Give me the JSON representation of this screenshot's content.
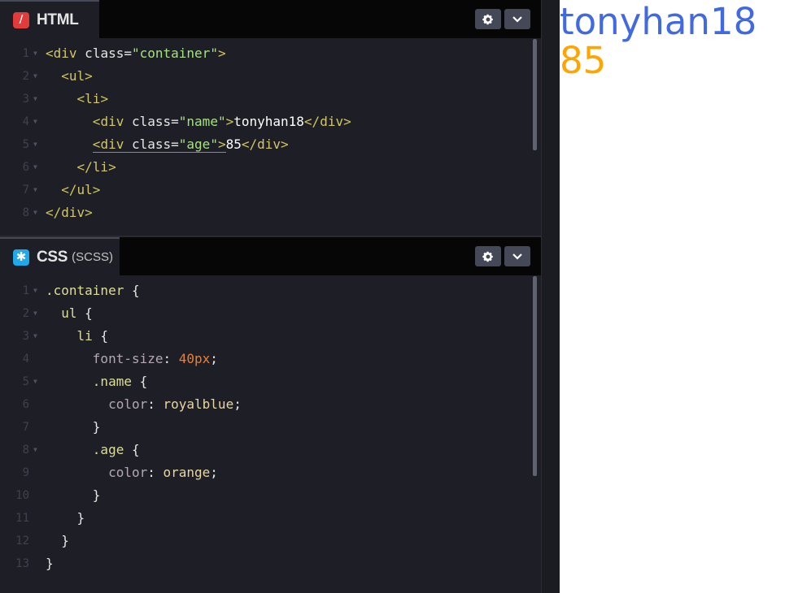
{
  "editor": {
    "html_pane": {
      "tab_title": "HTML",
      "tab_icon": "slash-icon",
      "lines": [
        [
          "1",
          "2",
          "3",
          "4",
          "5",
          "6",
          "7",
          "8"
        ]
      ],
      "code": {
        "l1": {
          "open": "<",
          "tag": "div",
          "attr": " class=",
          "str": "\"container\"",
          "close": ">"
        },
        "l2": {
          "open": "<",
          "tag": "ul",
          "close": ">"
        },
        "l3": {
          "open": "<",
          "tag": "li",
          "close": ">"
        },
        "l4": {
          "open": "<",
          "tag": "div",
          "attr": " class=",
          "str": "\"name\"",
          "close": ">",
          "text": "tonyhan18",
          "end_open": "</",
          "end_tag": "div",
          "end_close": ">"
        },
        "l5": {
          "open": "<",
          "tag": "div",
          "attr": " class=",
          "str": "\"age\"",
          "close": ">",
          "text": "85",
          "end_open": "</",
          "end_tag": "div",
          "end_close": ">"
        },
        "l6": {
          "end_open": "</",
          "end_tag": "li",
          "end_close": ">"
        },
        "l7": {
          "end_open": "</",
          "end_tag": "ul",
          "end_close": ">"
        },
        "l8": {
          "end_open": "</",
          "end_tag": "div",
          "end_close": ">"
        }
      }
    },
    "css_pane": {
      "tab_title": "CSS",
      "tab_subtitle": "(SCSS)",
      "tab_icon": "asterisk-icon",
      "code": {
        "l1": {
          "sel": ".container",
          "brace": " {"
        },
        "l2": {
          "sel": "ul",
          "brace": " {"
        },
        "l3": {
          "sel": "li",
          "brace": " {"
        },
        "l4": {
          "prop": "font-size",
          "colon": ": ",
          "value": "40px",
          "semi": ";"
        },
        "l5": {
          "sel": ".name",
          "brace": " {"
        },
        "l6": {
          "prop": "color",
          "colon": ": ",
          "value": "royalblue",
          "semi": ";"
        },
        "l7": {
          "brace": "}"
        },
        "l8": {
          "sel": ".age",
          "brace": " {"
        },
        "l9": {
          "prop": "color",
          "colon": ": ",
          "value": "orange",
          "semi": ";"
        },
        "l10": {
          "brace": "}"
        },
        "l11": {
          "brace": "}"
        },
        "l12": {
          "brace": "}"
        },
        "l13": {
          "brace": "}"
        }
      }
    },
    "line_numbers": [
      "1",
      "2",
      "3",
      "4",
      "5",
      "6",
      "7",
      "8",
      "9",
      "10",
      "11",
      "12",
      "13"
    ],
    "settings_icon": "gear-icon",
    "collapse_icon": "chevron-down-icon"
  },
  "preview": {
    "name": "tonyhan18",
    "age": "85",
    "name_color": "#4169e1",
    "age_color": "#ffa500"
  },
  "colors": {
    "editor_bg": "#1e1f26",
    "html_icon": "#e33a3a",
    "css_icon": "#1fa8ea"
  }
}
